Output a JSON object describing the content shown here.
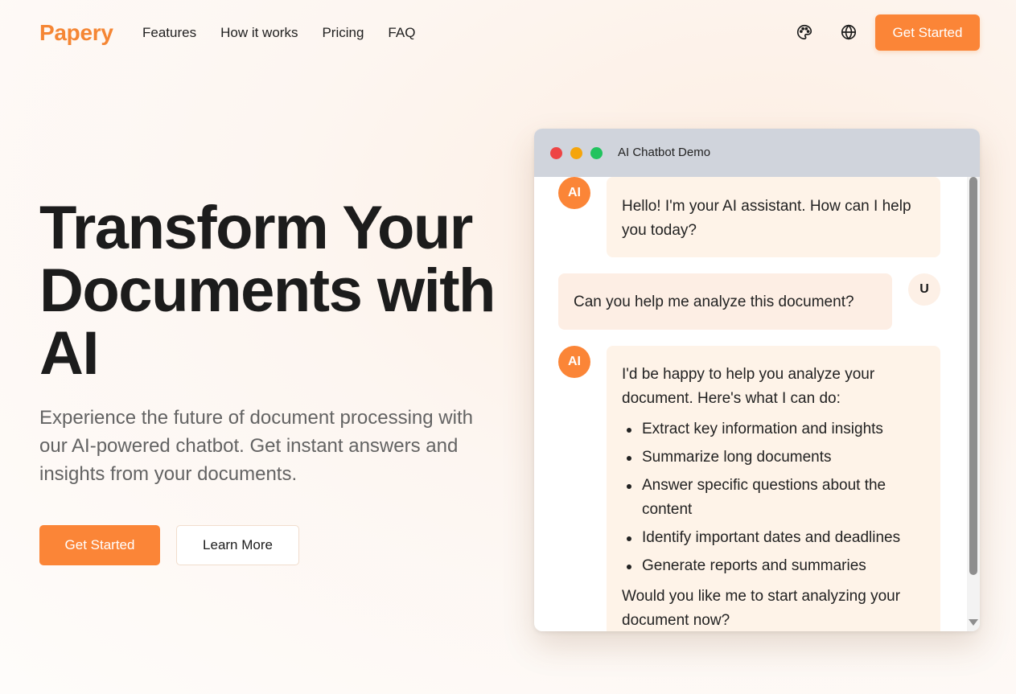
{
  "nav": {
    "logo": "Papery",
    "links": [
      "Features",
      "How it works",
      "Pricing",
      "FAQ"
    ],
    "theme_icon": "palette-icon",
    "language_icon": "globe-icon",
    "cta_label": "Get Started"
  },
  "hero": {
    "title": "Transform Your Documents with AI",
    "subtitle": "Experience the future of document processing with our AI-powered chatbot. Get instant answers and insights from your documents.",
    "primary_button": "Get Started",
    "secondary_button": "Learn More"
  },
  "chat": {
    "window_title": "AI Chatbot Demo",
    "dots": [
      "#ee4444",
      "#f5a50b",
      "#21c35e"
    ],
    "messages": [
      {
        "role": "ai",
        "avatar": "AI",
        "text": "Hello! I'm your AI assistant. How can I help you today?"
      },
      {
        "role": "user",
        "avatar": "U",
        "text": "Can you help me analyze this document?"
      },
      {
        "role": "ai",
        "avatar": "AI",
        "intro": "I'd be happy to help you analyze your document. Here's what I can do:",
        "items": [
          "Extract key information and insights",
          "Summarize long documents",
          "Answer specific questions about the content",
          "Identify important dates and deadlines",
          "Generate reports and summaries"
        ],
        "outro": "Would you like me to start analyzing your document now?"
      }
    ]
  },
  "colors": {
    "accent": "#fb8537",
    "ai_bubble": "#fef3e8",
    "user_bubble": "#fdeee4"
  }
}
